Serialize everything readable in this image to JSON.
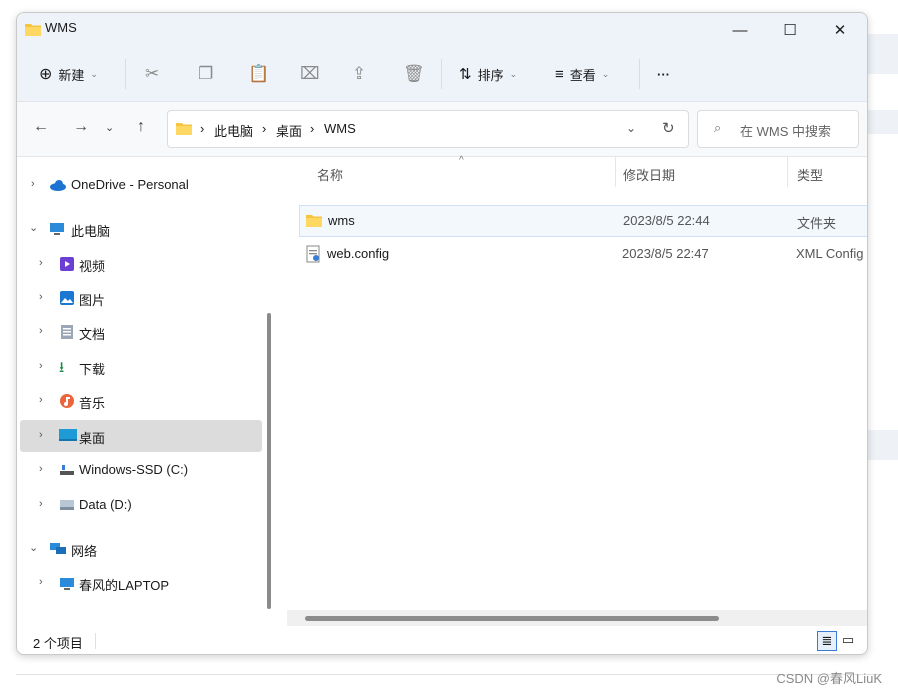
{
  "window": {
    "title": "WMS",
    "controls": {
      "minimize": "—",
      "maximize": "☐",
      "close": "✕"
    }
  },
  "toolbar": {
    "new_label": "新建",
    "sort_label": "排序",
    "view_label": "查看",
    "more_label": "···"
  },
  "address": {
    "segments": [
      "此电脑",
      "桌面",
      "WMS"
    ],
    "separator": "›",
    "search_placeholder": "在 WMS 中搜索"
  },
  "sidebar": {
    "items": [
      {
        "label": "OneDrive - Personal",
        "icon": "cloud-icon"
      },
      {
        "label": "此电脑",
        "icon": "computer-icon"
      },
      {
        "label": "视频",
        "icon": "video-icon"
      },
      {
        "label": "图片",
        "icon": "picture-icon"
      },
      {
        "label": "文档",
        "icon": "document-icon"
      },
      {
        "label": "下载",
        "icon": "download-icon"
      },
      {
        "label": "音乐",
        "icon": "music-icon"
      },
      {
        "label": "桌面",
        "icon": "desktop-icon"
      },
      {
        "label": "Windows-SSD (C:)",
        "icon": "drive-icon"
      },
      {
        "label": "Data (D:)",
        "icon": "drive-icon"
      },
      {
        "label": "网络",
        "icon": "network-icon"
      },
      {
        "label": "春风的LAPTOP",
        "icon": "computer-icon"
      }
    ]
  },
  "columns": {
    "name": "名称",
    "modified": "修改日期",
    "type": "类型"
  },
  "files": [
    {
      "name": "wms",
      "modified": "2023/8/5 22:44",
      "type": "文件夹"
    },
    {
      "name": "web.config",
      "modified": "2023/8/5 22:47",
      "type": "XML Config"
    }
  ],
  "status": {
    "count": "2 个项目"
  },
  "watermark": "CSDN @春风LiuK",
  "colors": {
    "folder": "#f5c542",
    "accent": "#0a64c8",
    "selection": "#dcdcdc"
  }
}
